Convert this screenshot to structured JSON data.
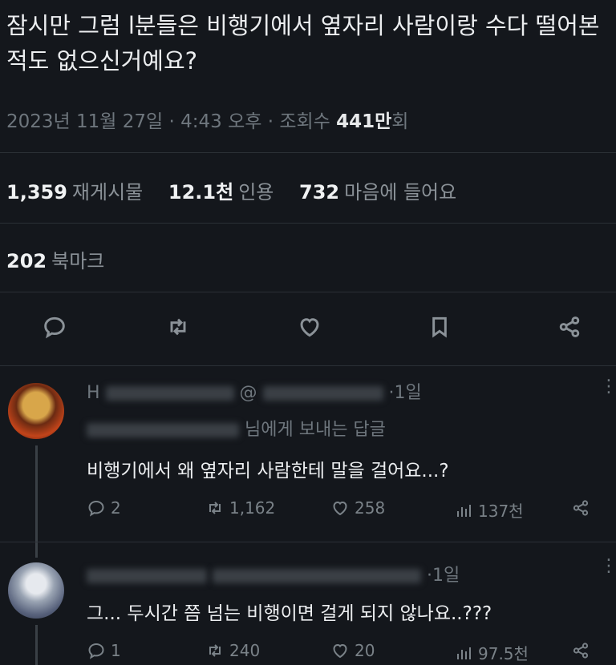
{
  "tweet": {
    "text": "잠시만 그럼 l분들은 비행기에서 옆자리 사람이랑 수다 떨어본 적도 없으신거예요?",
    "date": "2023년 11월 27일",
    "time": "4:43 오후",
    "views_label": "조회수",
    "views_count": "441만",
    "views_unit": "회"
  },
  "stats": {
    "retweets": "1,359",
    "retweets_label": "재게시물",
    "quotes": "12.1천",
    "quotes_label": "인용",
    "likes": "732",
    "likes_label": "마음에 들어요",
    "bookmarks": "202",
    "bookmarks_label": "북마크"
  },
  "actions": [
    "reply-icon",
    "retweet-icon",
    "heart-icon",
    "bookmark-icon",
    "share-icon"
  ],
  "replies": [
    {
      "name_partial": "H",
      "handle_partial": "@",
      "age": "·1일",
      "reply_to_suffix": "님에게 보내는 답글",
      "text": "비행기에서 왜 옆자리 사람한테 말을 걸어요...?",
      "replies": "2",
      "retweets": "1,162",
      "likes": "258",
      "views": "137천"
    },
    {
      "name_partial": "",
      "handle_partial": "",
      "age": "·1일",
      "reply_to_suffix": "",
      "text": "그... 두시간 쯤 넘는 비행이면 걸게 되지 않나요..???",
      "replies": "1",
      "retweets": "240",
      "likes": "20",
      "views": "97.5천"
    }
  ],
  "colors": {
    "background": "#14171c",
    "text": "#e7e9ea",
    "muted": "#6e767d"
  }
}
